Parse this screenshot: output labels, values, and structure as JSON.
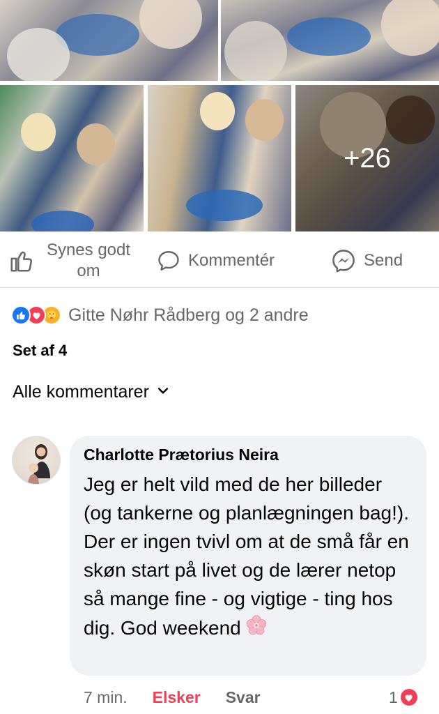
{
  "photos": {
    "more_count": "+26"
  },
  "actions": {
    "like_label": "Synes godt om",
    "comment_label": "Kommentér",
    "send_label": "Send"
  },
  "reactions": {
    "types": [
      "like",
      "love",
      "care"
    ],
    "names": "Gitte Nøhr Rådberg og 2 andre"
  },
  "seen_by": "Set af 4",
  "comments_filter": {
    "label": "Alle kommentarer",
    "icon": "chevron-down-icon"
  },
  "comment": {
    "author": "Charlotte Prætorius Neira",
    "text": "Jeg er helt vild med de her billeder (og tankerne og planlægningen bag!). Der er ingen tvivl om at de små får en skøn start på livet og de lærer netop så mange fine - og vigtige - ting hos dig. God weekend",
    "emoji_icon": "cherry-blossom-icon",
    "time": "7 min.",
    "reaction_button": "Elsker",
    "reply_button": "Svar",
    "reaction_count": "1",
    "reaction_type": "love"
  },
  "colors": {
    "brand_blue": "#1877f2",
    "love_red": "#f33e58",
    "secondary_text": "#65676b",
    "bubble_bg": "#f0f2f5"
  }
}
